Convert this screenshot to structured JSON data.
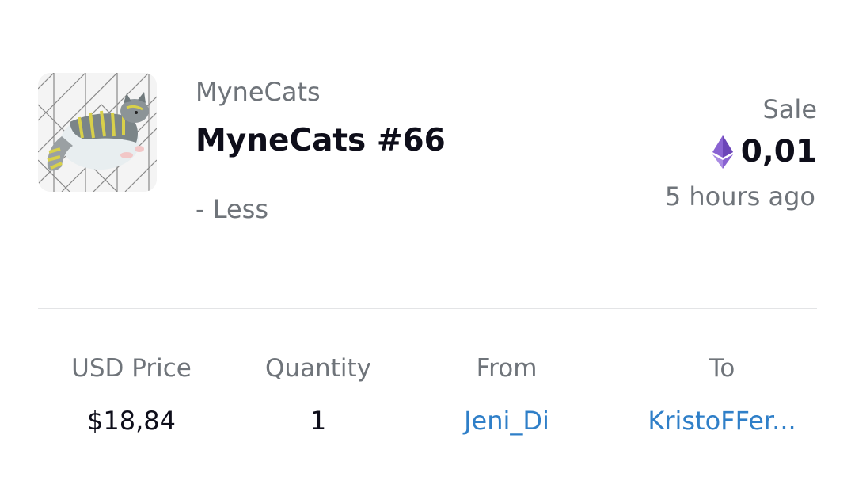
{
  "item": {
    "collection": "MyneCats",
    "name": "MyneCats #66",
    "toggle_label": "- Less",
    "thumbnail": "cat-nft-image"
  },
  "event": {
    "type": "Sale",
    "currency_icon": "ethereum-icon",
    "price": "0,01",
    "time": "5 hours ago"
  },
  "details": {
    "usd_label": "USD Price",
    "usd_value": "$18,84",
    "qty_label": "Quantity",
    "qty_value": "1",
    "from_label": "From",
    "from_value": "Jeni_Di",
    "to_label": "To",
    "to_value": "KristoFFer..."
  },
  "colors": {
    "link": "#2f7fc8",
    "muted": "#6f747a",
    "text": "#0e0e1a",
    "eth_purple": "#8a63d2"
  }
}
